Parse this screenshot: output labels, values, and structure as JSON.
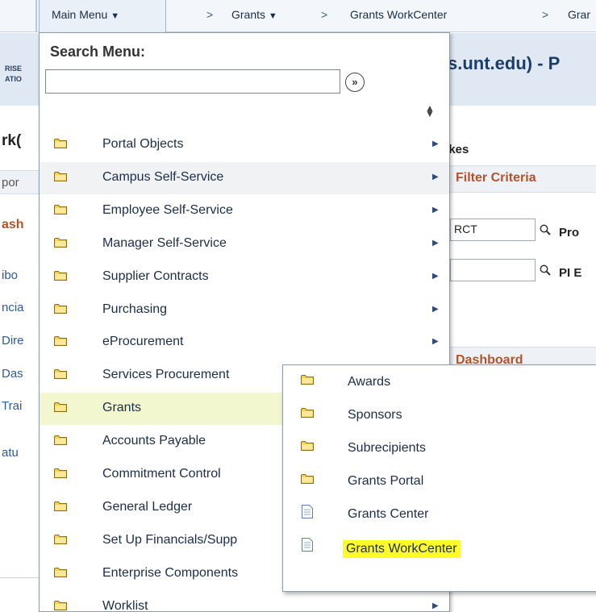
{
  "topnav": {
    "main_menu_label": "Main Menu",
    "breadcrumbs": [
      "Grants",
      "Grants WorkCenter",
      "Grar"
    ]
  },
  "banner": {
    "logo_line1": "RISE",
    "logo_line2": "ATIO",
    "title": "s.unt.edu) - P"
  },
  "background": {
    "heading_fragment": "rk(",
    "tab_fragment": "por",
    "section_fragment": "ash",
    "links": [
      "ibo",
      "ncia",
      "Dire",
      "Das",
      "Trai",
      "atu"
    ],
    "name_fragment": "ykes",
    "filter_criteria": "Filter Criteria",
    "input_value": "RCT",
    "label_pro": "Pro",
    "label_pi": "PI E",
    "dashboard_label": "Dashboard"
  },
  "menu": {
    "search_label": "Search Menu:",
    "search_value": "",
    "search_go_icon": "double-chevron-right-icon",
    "items": [
      {
        "label": "Portal Objects",
        "has_submenu": true
      },
      {
        "label": "Campus Self-Service",
        "has_submenu": true
      },
      {
        "label": "Employee Self-Service",
        "has_submenu": true
      },
      {
        "label": "Manager Self-Service",
        "has_submenu": true
      },
      {
        "label": "Supplier Contracts",
        "has_submenu": true
      },
      {
        "label": "Purchasing",
        "has_submenu": true
      },
      {
        "label": "eProcurement",
        "has_submenu": true
      },
      {
        "label": "Services Procurement",
        "has_submenu": true
      },
      {
        "label": "Grants",
        "has_submenu": true
      },
      {
        "label": "Accounts Payable",
        "has_submenu": true
      },
      {
        "label": "Commitment Control",
        "has_submenu": true
      },
      {
        "label": "General Ledger",
        "has_submenu": true
      },
      {
        "label": "Set Up Financials/Supp",
        "has_submenu": true
      },
      {
        "label": "Enterprise Components",
        "has_submenu": true
      },
      {
        "label": "Worklist",
        "has_submenu": true
      }
    ]
  },
  "submenu": {
    "items": [
      {
        "label": "Awards",
        "icon": "folder-icon"
      },
      {
        "label": "Sponsors",
        "icon": "folder-icon"
      },
      {
        "label": "Subrecipients",
        "icon": "folder-icon"
      },
      {
        "label": "Grants Portal",
        "icon": "folder-icon"
      },
      {
        "label": "Grants Center",
        "icon": "page-icon"
      },
      {
        "label": "Grants WorkCenter",
        "icon": "page-icon",
        "highlighted": true
      }
    ]
  },
  "colors": {
    "highlight": "#fffb29",
    "active_row": "#f3f7cf",
    "hover_row": "#f0f2f4",
    "folder": "#f4d257",
    "accent_text": "#b4532a"
  }
}
